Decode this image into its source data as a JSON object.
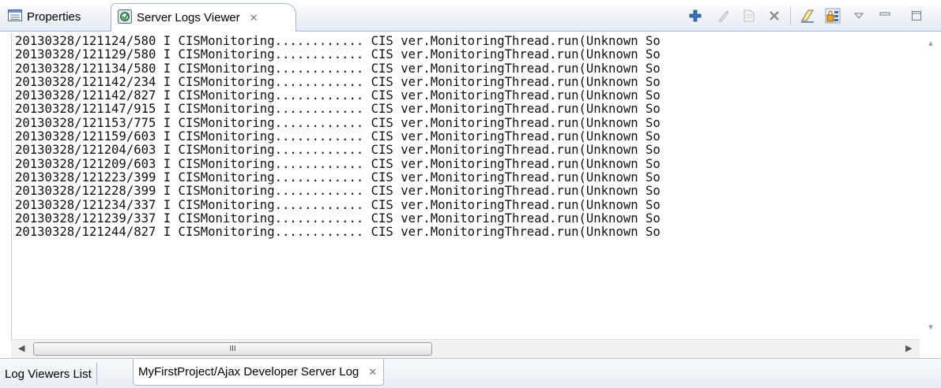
{
  "top_tabs": {
    "properties_label": "Properties",
    "server_logs_label": "Server Logs Viewer",
    "close_glyph": "✕"
  },
  "toolbar": {
    "icons": [
      "add-icon",
      "edit-icon",
      "document-icon",
      "delete-icon",
      "clear-icon",
      "lock-icon",
      "view-menu-icon",
      "minimize-icon",
      "maximize-icon"
    ]
  },
  "log": {
    "lines": [
      "20130328/121124/580 I CISMonitoring............ CIS ver.MonitoringThread.run(Unknown So",
      "20130328/121129/580 I CISMonitoring............ CIS ver.MonitoringThread.run(Unknown So",
      "20130328/121134/580 I CISMonitoring............ CIS ver.MonitoringThread.run(Unknown So",
      "20130328/121142/234 I CISMonitoring............ CIS ver.MonitoringThread.run(Unknown So",
      "20130328/121142/827 I CISMonitoring............ CIS ver.MonitoringThread.run(Unknown So",
      "20130328/121147/915 I CISMonitoring............ CIS ver.MonitoringThread.run(Unknown So",
      "20130328/121153/775 I CISMonitoring............ CIS ver.MonitoringThread.run(Unknown So",
      "20130328/121159/603 I CISMonitoring............ CIS ver.MonitoringThread.run(Unknown So",
      "20130328/121204/603 I CISMonitoring............ CIS ver.MonitoringThread.run(Unknown So",
      "20130328/121209/603 I CISMonitoring............ CIS ver.MonitoringThread.run(Unknown So",
      "20130328/121223/399 I CISMonitoring............ CIS ver.MonitoringThread.run(Unknown So",
      "20130328/121228/399 I CISMonitoring............ CIS ver.MonitoringThread.run(Unknown So",
      "20130328/121234/337 I CISMonitoring............ CIS ver.MonitoringThread.run(Unknown So",
      "20130328/121239/337 I CISMonitoring............ CIS ver.MonitoringThread.run(Unknown So",
      "20130328/121244/827 I CISMonitoring............ CIS ver.MonitoringThread.run(Unknown So"
    ]
  },
  "hscroll": {
    "thumb_grip": "III"
  },
  "bottom_tabs": {
    "log_viewers_label": "Log Viewers List",
    "ajax_log_label": "MyFirstProject/Ajax Developer Server Log",
    "close_glyph": "✕"
  },
  "colors": {
    "accent_blue": "#3a6fb5",
    "border": "#a9b7cc"
  }
}
